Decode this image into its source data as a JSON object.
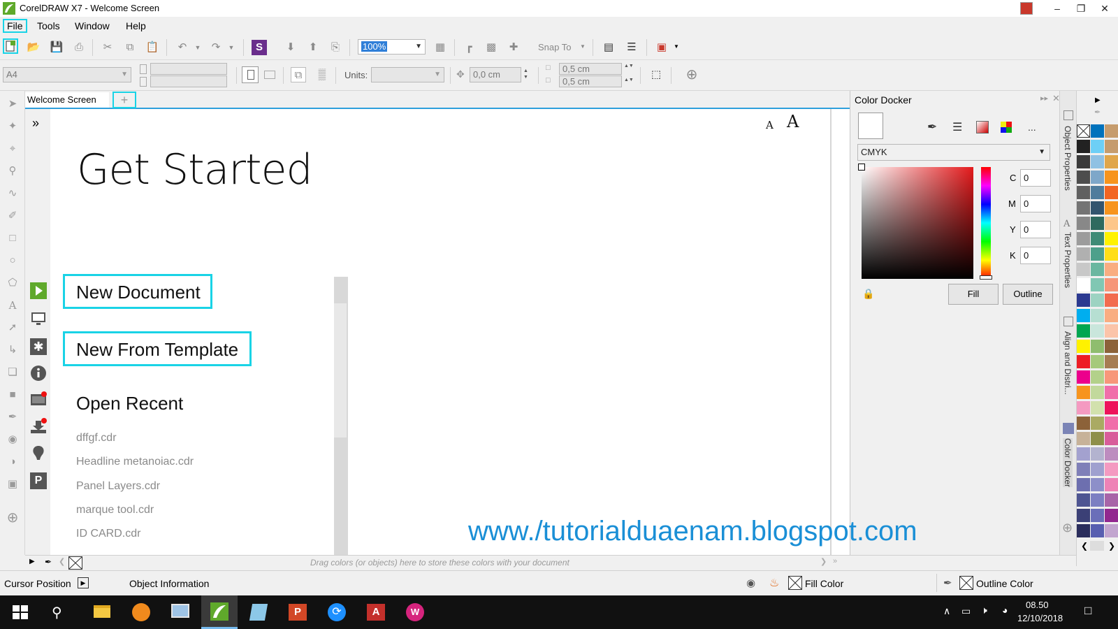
{
  "window": {
    "title": "CorelDRAW X7 - Welcome Screen"
  },
  "menu": [
    "File",
    "Tools",
    "Window",
    "Help"
  ],
  "toolbar": {
    "zoom": "100%",
    "snap_to": "Snap To"
  },
  "property_bar": {
    "page_size": "A4",
    "units_label": "Units:",
    "nudge": "0,0 cm",
    "dup_h": "0,5 cm",
    "dup_v": "0,5 cm"
  },
  "tabs": {
    "active": "Welcome Screen"
  },
  "welcome": {
    "font_small": "A",
    "font_large": "A",
    "heading": "Get Started",
    "new_document": "New Document",
    "new_from_template": "New From Template",
    "open_recent": "Open Recent",
    "recent_files": [
      "dffgf.cdr",
      "Headline metanoiac.cdr",
      "Panel Layers.cdr",
      "marque tool.cdr",
      "ID CARD.cdr"
    ]
  },
  "color_docker": {
    "title": "Color Docker",
    "model": "CMYK",
    "c_label": "C",
    "c": "0",
    "m_label": "M",
    "m": "0",
    "y_label": "Y",
    "y": "0",
    "k_label": "K",
    "k": "0",
    "fill_button": "Fill",
    "outline_button": "Outline",
    "more": "..."
  },
  "docker_tabs": [
    "Object Properties",
    "Text Properties",
    "Align and Distri...",
    "Color Docker"
  ],
  "doc_palette_hint": "Drag colors (or objects) here to store these colors with your document",
  "status": {
    "cursor_position": "Cursor Position",
    "object_information": "Object Information",
    "fill_color": "Fill Color",
    "outline_color": "Outline Color"
  },
  "watermark": "www./tutorialduaenam.blogspot.com",
  "taskbar": {
    "time": "08.50",
    "date": "12/10/2018"
  },
  "colors": {
    "accent": "#19d3e6",
    "tab_line": "#2e9fdc",
    "watermark": "#1a8fd6",
    "coreldraw_green": "#5fa92b"
  }
}
